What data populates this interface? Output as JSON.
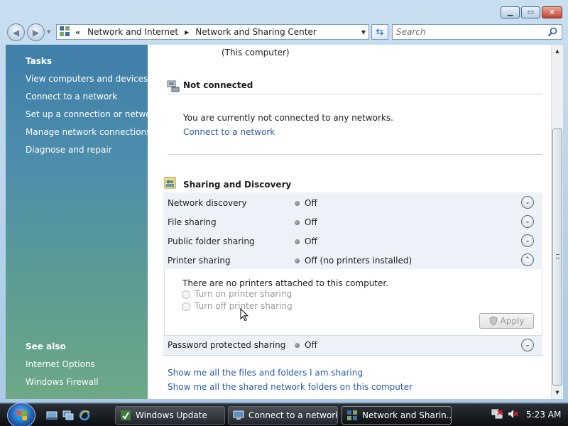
{
  "window": {
    "caption_buttons": {
      "minimize": "minimize-icon",
      "maximize": "maximize-icon",
      "close": "close-icon"
    }
  },
  "address": {
    "chevron": "«",
    "crumbs": [
      "Network and Internet",
      "Network and Sharing Center"
    ],
    "search_placeholder": "Search"
  },
  "taskpane": {
    "tasks_heading": "Tasks",
    "tasks": [
      "View computers and devices",
      "Connect to a network",
      "Set up a connection or network",
      "Manage network connections",
      "Diagnose and repair"
    ],
    "see_also_heading": "See also",
    "see_also": [
      "Internet Options",
      "Windows Firewall"
    ]
  },
  "main": {
    "this_computer": "(This computer)",
    "network": {
      "title": "Not connected",
      "message": "You are currently not connected to any networks.",
      "connect_link": "Connect to a network"
    },
    "sharing": {
      "title": "Sharing and Discovery",
      "rows": [
        {
          "label": "Network discovery",
          "status": "Off"
        },
        {
          "label": "File sharing",
          "status": "Off"
        },
        {
          "label": "Public folder sharing",
          "status": "Off"
        },
        {
          "label": "Printer sharing",
          "status": "Off (no printers installed)"
        },
        {
          "label": "Password protected sharing",
          "status": "Off"
        }
      ],
      "printer_panel": {
        "message": "There are no printers attached to this computer.",
        "option_on": "Turn on printer sharing",
        "option_off": "Turn off printer sharing",
        "apply": "Apply"
      }
    },
    "links": [
      "Show me all the files and folders I am sharing",
      "Show me all the shared network folders on this computer"
    ]
  },
  "taskbar": {
    "buttons": [
      "Windows Update",
      "Connect to a network",
      "Network and Sharin..."
    ],
    "active_index": 2,
    "clock": "5:23 AM"
  }
}
